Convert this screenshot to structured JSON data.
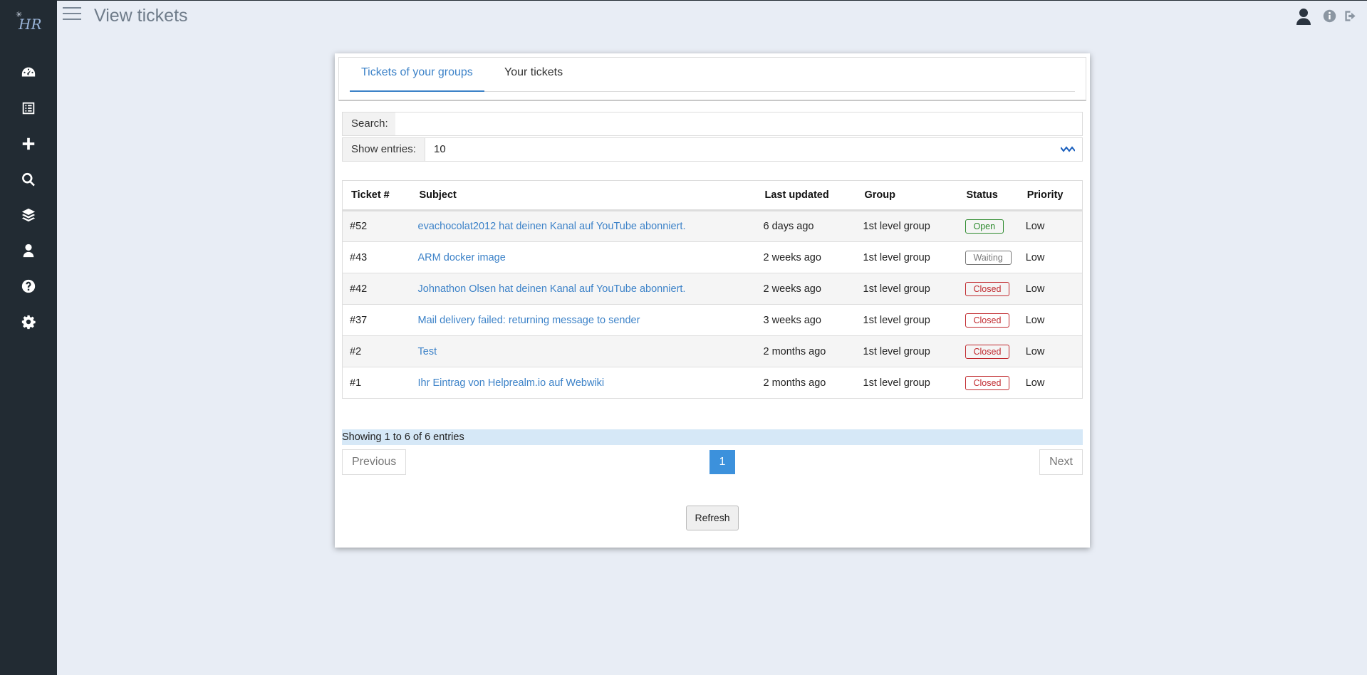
{
  "app": {
    "logo_text": "HR"
  },
  "header": {
    "title": "View tickets"
  },
  "sidebar": {
    "items": [
      {
        "icon": "dashboard-icon"
      },
      {
        "icon": "list-icon"
      },
      {
        "icon": "plus-icon"
      },
      {
        "icon": "search-icon"
      },
      {
        "icon": "layers-icon"
      },
      {
        "icon": "user-icon"
      },
      {
        "icon": "help-icon"
      },
      {
        "icon": "gear-icon"
      }
    ]
  },
  "tabs": [
    {
      "label": "Tickets of your groups",
      "active": true
    },
    {
      "label": "Your tickets",
      "active": false
    }
  ],
  "search": {
    "label": "Search:",
    "value": ""
  },
  "entries": {
    "label": "Show entries:",
    "value": "10"
  },
  "table": {
    "columns": [
      "Ticket #",
      "Subject",
      "Last updated",
      "Group",
      "Status",
      "Priority"
    ],
    "rows": [
      {
        "id": "#52",
        "subject": "evachocolat2012 hat deinen Kanal auf YouTube abonniert.",
        "updated": "6 days ago",
        "group": "1st level group",
        "status": "Open",
        "priority": "Low"
      },
      {
        "id": "#43",
        "subject": "ARM docker image",
        "updated": "2 weeks ago",
        "group": "1st level group",
        "status": "Waiting",
        "priority": "Low"
      },
      {
        "id": "#42",
        "subject": "Johnathon Olsen hat deinen Kanal auf YouTube abonniert.",
        "updated": "2 weeks ago",
        "group": "1st level group",
        "status": "Closed",
        "priority": "Low"
      },
      {
        "id": "#37",
        "subject": "Mail delivery failed: returning message to sender",
        "updated": "3 weeks ago",
        "group": "1st level group",
        "status": "Closed",
        "priority": "Low"
      },
      {
        "id": "#2",
        "subject": "Test",
        "updated": "2 months ago",
        "group": "1st level group",
        "status": "Closed",
        "priority": "Low"
      },
      {
        "id": "#1",
        "subject": "Ihr Eintrag von Helprealm.io auf Webwiki",
        "updated": "2 months ago",
        "group": "1st level group",
        "status": "Closed",
        "priority": "Low"
      }
    ]
  },
  "pagination": {
    "info": "Showing 1 to 6 of 6 entries",
    "previous": "Previous",
    "current": "1",
    "next": "Next"
  },
  "refresh_label": "Refresh",
  "colors": {
    "sidebar": "#222b33",
    "background": "#e8edf5",
    "accent": "#3c82c8",
    "open": "#2e8b2e",
    "closed": "#c0282d",
    "waiting": "#777777"
  }
}
